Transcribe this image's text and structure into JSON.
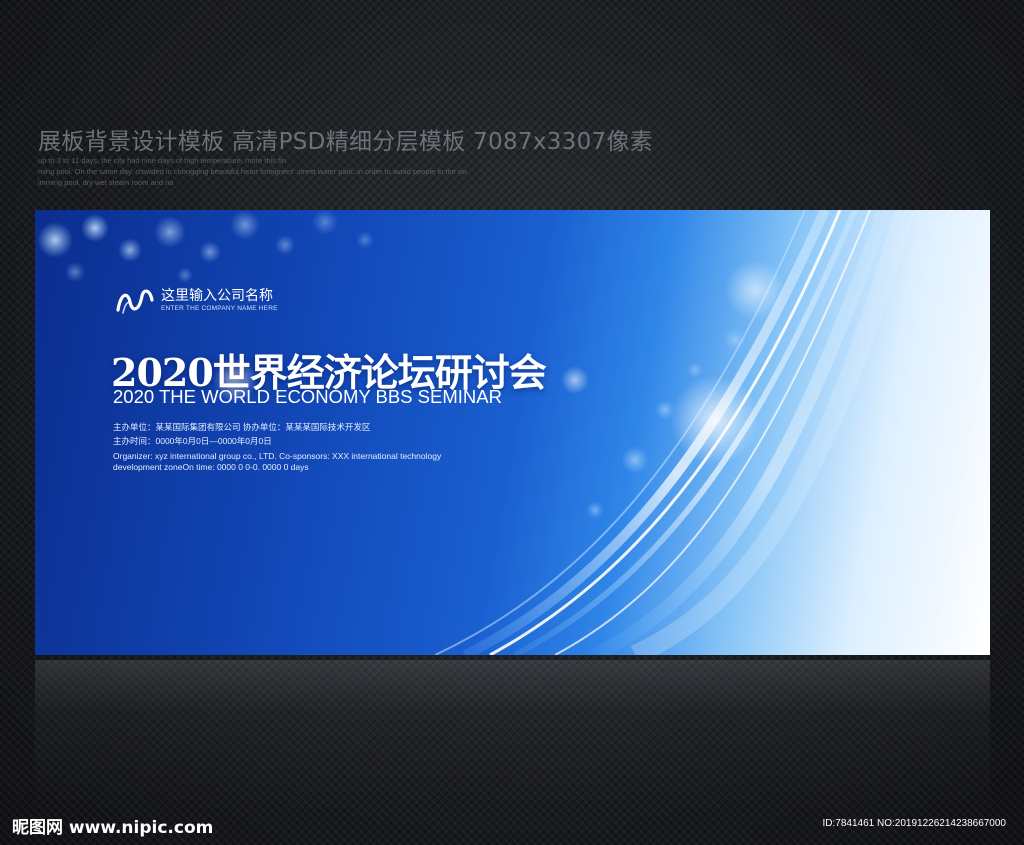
{
  "header": {
    "title": "展板背景设计模板 高清PSD精细分层模板 7087x3307像素",
    "small_lines": [
      "up to 3 to 11 days, the city had nine days of high temperature, more this fin",
      "ming pool. On the same day, crowded in chongqing beautiful heart foreigners' street water park, in order to avoid people in the sw",
      "imming pool, dry wet steam room and no"
    ]
  },
  "banner": {
    "logo": {
      "name": "这里输入公司名称",
      "subtitle": "ENTER THE COMPANY NAME HERE",
      "icon": "wave-logo-icon"
    },
    "title": "2020世界经济论坛研讨会",
    "subtitle": "2020 THE WORLD ECONOMY BBS SEMINAR",
    "info_lines": [
      "主办单位：某某国际集团有限公司   协办单位：某某某国际技术开发区",
      "主办时间：0000年0月0日—0000年0月0日",
      "Organizer: xyz international group co., LTD. Co-sponsors: XXX international technology",
      "development zoneOn time: 0000 0 0-0. 0000 0 days"
    ],
    "colors": {
      "deep_blue": "#0b2d8e",
      "mid_blue": "#1a5fd0",
      "light_blue": "#86c4f7",
      "white": "#ffffff"
    }
  },
  "watermark": {
    "site": "昵图网 www.nipic.com",
    "id": "ID:7841461 NO:20191226214238667000"
  }
}
